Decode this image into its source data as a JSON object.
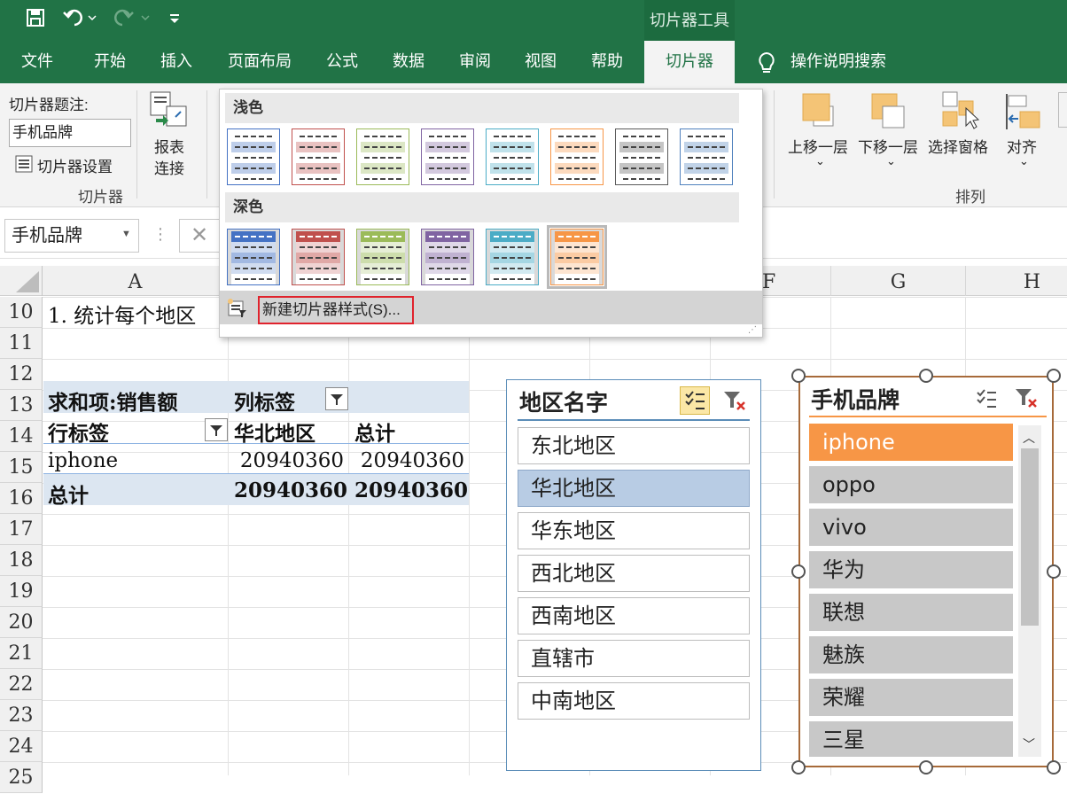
{
  "qat": {
    "save_icon": "save-icon",
    "undo_icon": "undo-icon",
    "redo_icon": "redo-icon",
    "customize_icon": "customize-icon"
  },
  "contextual_tab": "切片器工具",
  "menu_tabs": [
    {
      "label": "文件"
    },
    {
      "label": "开始"
    },
    {
      "label": "插入"
    },
    {
      "label": "页面布局"
    },
    {
      "label": "公式"
    },
    {
      "label": "数据"
    },
    {
      "label": "审阅"
    },
    {
      "label": "视图"
    },
    {
      "label": "帮助"
    },
    {
      "label": "切片器"
    }
  ],
  "tell_me": "操作说明搜索",
  "ribbon": {
    "caption_label": "切片器题注:",
    "caption_value": "手机品牌",
    "settings_label": "切片器设置",
    "group_slicer": "切片器",
    "report_connections_line1": "报表",
    "report_connections_line2": "连接",
    "bring_forward": "上移一层",
    "send_backward": "下移一层",
    "selection_pane": "选择窗格",
    "align": "对齐",
    "group_arrange": "排列"
  },
  "gallery": {
    "light_header": "浅色",
    "dark_header": "深色",
    "new_style": "新建切片器样式(S)...",
    "light_colors": [
      "#4472c4",
      "#c0504d",
      "#9bbb59",
      "#8064a2",
      "#4bacc6",
      "#f79646",
      "#595959",
      "#4f81bd"
    ],
    "dark_colors": [
      "#4472c4",
      "#c0504d",
      "#9bbb59",
      "#8064a2",
      "#4bacc6",
      "#f79646"
    ]
  },
  "name_box": "手机品牌",
  "columns": [
    "A",
    "F",
    "G",
    "H"
  ],
  "rows": [
    "10",
    "11",
    "12",
    "13",
    "14",
    "15",
    "16",
    "17",
    "18",
    "19",
    "20",
    "21",
    "22",
    "23",
    "24",
    "25"
  ],
  "cells": {
    "a10": "1. 统计每个地区",
    "sum_label": "求和项:销售额",
    "col_label": "列标签",
    "row_label": "行标签",
    "region_header": "华北地区",
    "total_header": "总计",
    "r15_label": "iphone",
    "r15_v1": "20940360",
    "r15_v2": "20940360",
    "r16_label": "总计",
    "r16_v1": "20940360",
    "r16_v2": "20940360"
  },
  "slicer_region": {
    "title": "地区名字",
    "items": [
      "东北地区",
      "华北地区",
      "华东地区",
      "西北地区",
      "西南地区",
      "直辖市",
      "中南地区"
    ],
    "selected": "华北地区"
  },
  "slicer_brand": {
    "title": "手机品牌",
    "items": [
      "iphone",
      "oppo",
      "vivo",
      "华为",
      "联想",
      "魅族",
      "荣耀",
      "三星"
    ],
    "selected": "iphone"
  }
}
